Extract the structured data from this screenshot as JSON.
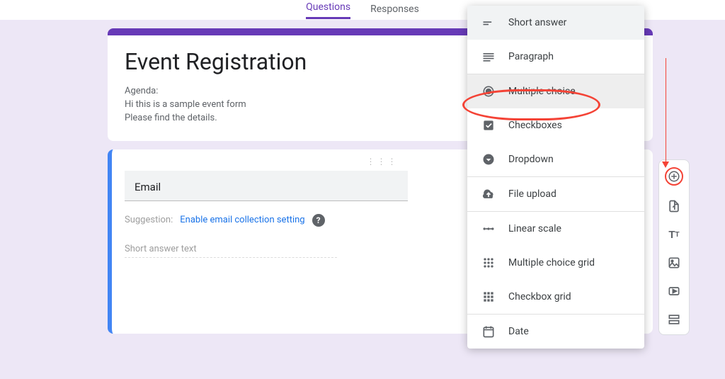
{
  "tabs": {
    "questions": "Questions",
    "responses": "Responses"
  },
  "header": {
    "title": "Event Registration",
    "desc_line1": "Agenda:",
    "desc_line2": "Hi this is a sample event form",
    "desc_line3": "Please find the details."
  },
  "question": {
    "title": "Email",
    "suggestion_label": "Suggestion:",
    "suggestion_link": "Enable email collection setting",
    "answer_placeholder": "Short answer text"
  },
  "menu": {
    "short_answer": "Short answer",
    "paragraph": "Paragraph",
    "multiple_choice": "Multiple choice",
    "checkboxes": "Checkboxes",
    "dropdown": "Dropdown",
    "file_upload": "File upload",
    "linear_scale": "Linear scale",
    "mc_grid": "Multiple choice grid",
    "cb_grid": "Checkbox grid",
    "date": "Date"
  }
}
